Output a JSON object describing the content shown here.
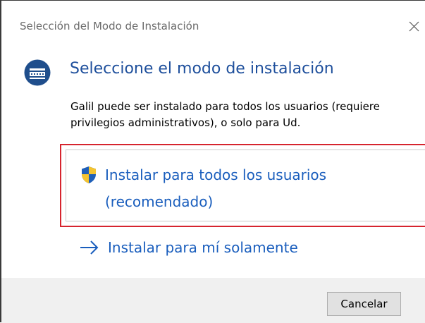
{
  "window": {
    "title": "Selección del Modo de Instalación"
  },
  "main": {
    "heading": "Seleccione el modo de instalación",
    "description": "Galil puede ser instalado para todos los usuarios (requiere privilegios administrativos), o solo para Ud.",
    "options": [
      {
        "line1": "Instalar para todos los usuarios",
        "line2": "(recomendado)",
        "icon": "uac-shield-icon",
        "highlighted": true
      },
      {
        "line1": "Instalar para mí solamente",
        "icon": "right-arrow-icon"
      }
    ]
  },
  "footer": {
    "cancel_label": "Cancelar"
  },
  "colors": {
    "heading": "#1e4f9c",
    "link": "#1a5ebd",
    "highlight_border": "#d6242e",
    "footer_bg": "#f0f0f0"
  }
}
